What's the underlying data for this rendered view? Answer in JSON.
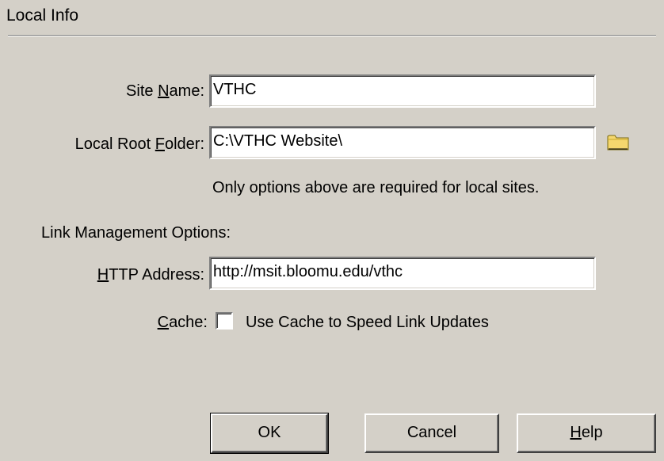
{
  "header": {
    "title": "Local Info"
  },
  "site_name": {
    "label_pre": "Site ",
    "label_key": "N",
    "label_post": "ame:",
    "value": "VTHC"
  },
  "root_folder": {
    "label_pre": "Local Root ",
    "label_key": "F",
    "label_post": "older:",
    "value": "C:\\VTHC Website\\",
    "browse_icon": "folder-icon"
  },
  "local_note": "Only options above are required for local sites.",
  "link_section_title": "Link Management Options:",
  "http_address": {
    "label_key": "H",
    "label_post": "TTP Address:",
    "value": "http://msit.bloomu.edu/vthc"
  },
  "cache": {
    "label_key": "C",
    "label_post": "ache:",
    "checkbox_label": "Use Cache to Speed Link Updates",
    "checked": false
  },
  "buttons": {
    "ok": "OK",
    "cancel": "Cancel",
    "help_key": "H",
    "help_rest": "elp"
  },
  "colors": {
    "dialog_bg": "#d4d0c8",
    "field_bg": "#ffffff",
    "folder": "#f5d76e"
  }
}
